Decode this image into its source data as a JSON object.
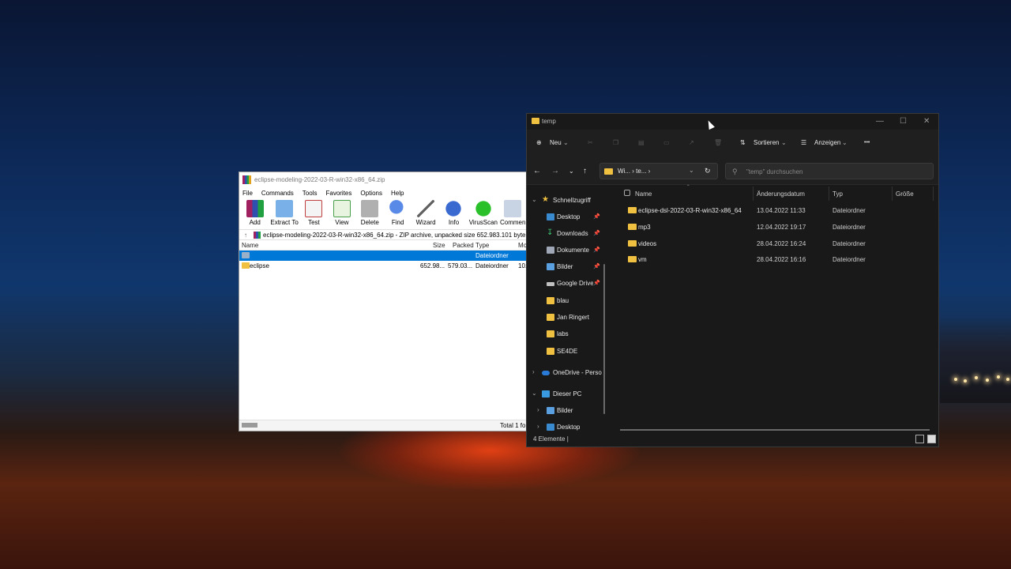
{
  "winrar": {
    "title": "eclipse-modeling-2022-03-R-win32-x86_64.zip",
    "menu": [
      "File",
      "Commands",
      "Tools",
      "Favorites",
      "Options",
      "Help"
    ],
    "toolbar": [
      {
        "label": "Add",
        "icon": "add-icon",
        "color": "#c83a6a"
      },
      {
        "label": "Extract To",
        "icon": "extract-folder-icon",
        "color": "#4a8ad8"
      },
      {
        "label": "Test",
        "icon": "test-checklist-icon",
        "color": "#d84040"
      },
      {
        "label": "View",
        "icon": "view-book-icon",
        "color": "#4aa04a"
      },
      {
        "label": "Delete",
        "icon": "trash-icon",
        "color": "#9a9a9a"
      },
      {
        "label": "Find",
        "icon": "magnifier-icon",
        "color": "#2a5ad0"
      },
      {
        "label": "Wizard",
        "icon": "wand-icon",
        "color": "#707070"
      },
      {
        "label": "Info",
        "icon": "info-icon",
        "color": "#3a6ad0"
      },
      {
        "label": "VirusScan",
        "icon": "virus-scan-icon",
        "color": "#2aa02a"
      },
      {
        "label": "Commen",
        "icon": "comment-icon",
        "color": "#8aa0c0"
      }
    ],
    "path": "eclipse-modeling-2022-03-R-win32-x86_64.zip - ZIP archive, unpacked size 652.983.101 byte",
    "columns": {
      "name": "Name",
      "size": "Size",
      "packed": "Packed",
      "type": "Type",
      "mod": "Mo"
    },
    "rows": [
      {
        "name": "",
        "size": "",
        "packed": "",
        "type": "Dateiordner",
        "mod": ""
      },
      {
        "name": "eclipse",
        "size": "652.98...",
        "packed": "579.03...",
        "type": "Dateiordner",
        "mod": "10."
      }
    ],
    "status": "Total 1 fo"
  },
  "explorer": {
    "title": "temp",
    "commands": {
      "new": "Neu",
      "sort": "Sortieren",
      "view": "Anzeigen",
      "more": "•••"
    },
    "breadcrumb": "Wi...  ›  te...  ›",
    "search_placeholder": "\"temp\" durchsuchen",
    "sidebar": [
      {
        "label": "Schnellzugriff",
        "icon": "star-icon",
        "kind": "group"
      },
      {
        "label": "Desktop",
        "icon": "desktop-icon",
        "pinned": true
      },
      {
        "label": "Downloads",
        "icon": "download-icon",
        "pinned": true
      },
      {
        "label": "Dokumente",
        "icon": "documents-icon",
        "pinned": true
      },
      {
        "label": "Bilder",
        "icon": "pictures-icon",
        "pinned": true
      },
      {
        "label": "Google Drive",
        "icon": "drive-icon",
        "pinned": true
      },
      {
        "label": "blau",
        "icon": "folder-icon"
      },
      {
        "label": "Jan Ringert",
        "icon": "folder-icon"
      },
      {
        "label": "labs",
        "icon": "folder-icon"
      },
      {
        "label": "SE4DE",
        "icon": "folder-icon"
      },
      {
        "label": "OneDrive - Perso",
        "icon": "onedrive-icon",
        "kind": "group"
      },
      {
        "label": "Dieser PC",
        "icon": "pc-icon",
        "kind": "group"
      },
      {
        "label": "Bilder",
        "icon": "pictures-icon",
        "kind": "sub"
      },
      {
        "label": "Desktop",
        "icon": "desktop-icon",
        "kind": "sub"
      }
    ],
    "columns": {
      "name": "Name",
      "date": "Änderungsdatum",
      "type": "Typ",
      "size": "Größe"
    },
    "files": [
      {
        "name": "eclipse-dsl-2022-03-R-win32-x86_64",
        "date": "13.04.2022 11:33",
        "type": "Dateiordner"
      },
      {
        "name": "mp3",
        "date": "12.04.2022 19:17",
        "type": "Dateiordner"
      },
      {
        "name": "videos",
        "date": "28.04.2022 16:24",
        "type": "Dateiordner"
      },
      {
        "name": "vm",
        "date": "28.04.2022 16:16",
        "type": "Dateiordner"
      }
    ],
    "status": "4 Elemente  |"
  }
}
